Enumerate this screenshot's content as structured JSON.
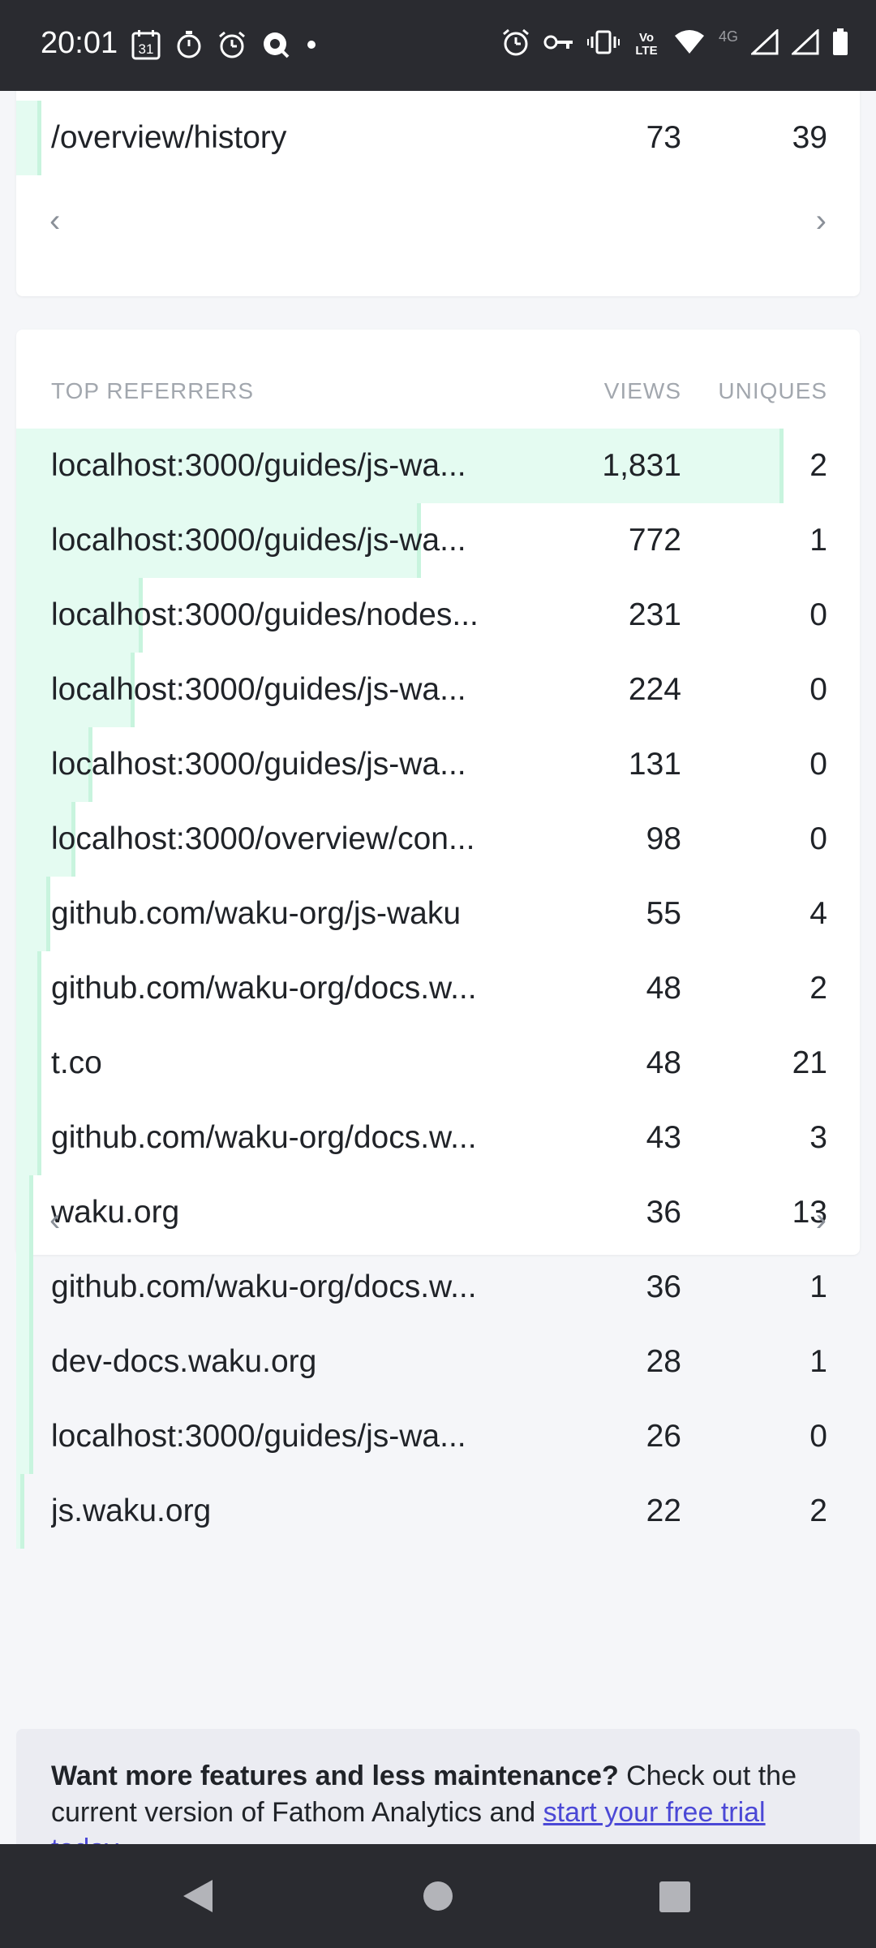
{
  "status_bar": {
    "time": "20:01",
    "calendar_day": "31",
    "network": "4G",
    "volte": "Vo LTE"
  },
  "pages_card": {
    "last_row": {
      "path": "/overview/history",
      "views": "73",
      "uniques": "39",
      "bar_fraction": 0.03
    },
    "prev_label": "‹",
    "next_label": "›"
  },
  "referrers": {
    "header": {
      "title": "TOP REFERRERS",
      "views": "VIEWS",
      "uniques": "UNIQUES"
    },
    "rows": [
      {
        "name": "localhost:3000/guides/js-wa...",
        "views": "1,831",
        "uniques": "2",
        "bar_fraction": 0.91
      },
      {
        "name": "localhost:3000/guides/js-wa...",
        "views": "772",
        "uniques": "1",
        "bar_fraction": 0.48
      },
      {
        "name": "localhost:3000/guides/nodes...",
        "views": "231",
        "uniques": "0",
        "bar_fraction": 0.15
      },
      {
        "name": "localhost:3000/guides/js-wa...",
        "views": "224",
        "uniques": "0",
        "bar_fraction": 0.14
      },
      {
        "name": "localhost:3000/guides/js-wa...",
        "views": "131",
        "uniques": "0",
        "bar_fraction": 0.09
      },
      {
        "name": "localhost:3000/overview/con...",
        "views": "98",
        "uniques": "0",
        "bar_fraction": 0.07
      },
      {
        "name": "github.com/waku-org/js-waku",
        "views": "55",
        "uniques": "4",
        "bar_fraction": 0.04
      },
      {
        "name": "github.com/waku-org/docs.w...",
        "views": "48",
        "uniques": "2",
        "bar_fraction": 0.03
      },
      {
        "name": "t.co",
        "views": "48",
        "uniques": "21",
        "bar_fraction": 0.03
      },
      {
        "name": "github.com/waku-org/docs.w...",
        "views": "43",
        "uniques": "3",
        "bar_fraction": 0.03
      },
      {
        "name": "waku.org",
        "views": "36",
        "uniques": "13",
        "bar_fraction": 0.02
      },
      {
        "name": "github.com/waku-org/docs.w...",
        "views": "36",
        "uniques": "1",
        "bar_fraction": 0.02
      },
      {
        "name": "dev-docs.waku.org",
        "views": "28",
        "uniques": "1",
        "bar_fraction": 0.02
      },
      {
        "name": "localhost:3000/guides/js-wa...",
        "views": "26",
        "uniques": "0",
        "bar_fraction": 0.02
      },
      {
        "name": "js.waku.org",
        "views": "22",
        "uniques": "2",
        "bar_fraction": 0.01
      }
    ],
    "prev_label": "‹",
    "next_label": "›"
  },
  "promo": {
    "bold": "Want more features and less maintenance?",
    "text": " Check out the current version of Fathom Analytics and ",
    "link": "start your free trial today"
  },
  "colors": {
    "bar_fill": "#e4fbf1",
    "bar_edge": "#c8f4de",
    "status_bar": "#2a2b30",
    "link": "#4b48d6"
  }
}
